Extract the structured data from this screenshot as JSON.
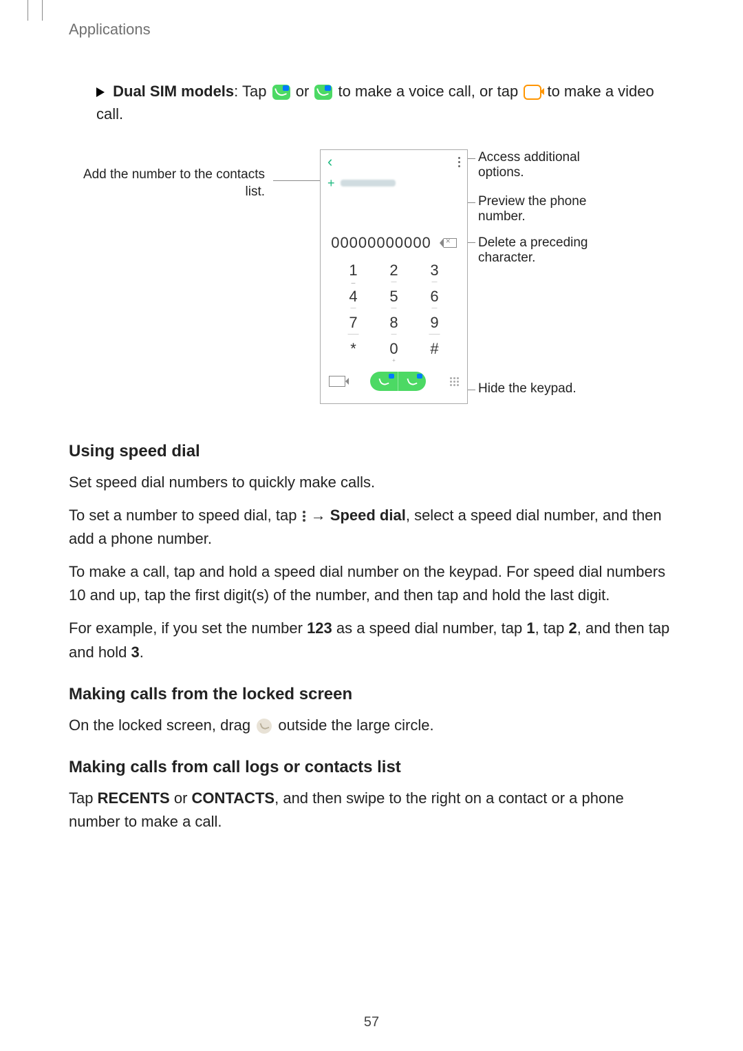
{
  "header": "Applications",
  "intro": {
    "lead": "Dual SIM models",
    "mid1": ": Tap ",
    "mid2": " or ",
    "mid3": " to make a voice call, or tap ",
    "tail": " to make a video call."
  },
  "annotations": {
    "add_contacts": "Add the number to the contacts list.",
    "access_options": "Access additional options.",
    "preview_number": "Preview the phone number.",
    "delete_char": "Delete a preceding character.",
    "hide_keypad": "Hide the keypad."
  },
  "phone": {
    "number_display": "00000000000",
    "keys": [
      "1",
      "2",
      "3",
      "4",
      "5",
      "6",
      "7",
      "8",
      "9",
      "*",
      "0",
      "#"
    ]
  },
  "sections": {
    "speed_dial": {
      "title": "Using speed dial",
      "p1": "Set speed dial numbers to quickly make calls.",
      "p2a": "To set a number to speed dial, tap ",
      "p2_arrow": " → ",
      "p2_bold": "Speed dial",
      "p2b": ", select a speed dial number, and then add a phone number.",
      "p3": "To make a call, tap and hold a speed dial number on the keypad. For speed dial numbers 10 and up, tap the first digit(s) of the number, and then tap and hold the last digit.",
      "p4a": "For example, if you set the number ",
      "p4_n1": "123",
      "p4b": " as a speed dial number, tap ",
      "p4_n2": "1",
      "p4c": ", tap ",
      "p4_n3": "2",
      "p4d": ", and then tap and hold ",
      "p4_n4": "3",
      "p4e": "."
    },
    "locked": {
      "title": "Making calls from the locked screen",
      "p1a": "On the locked screen, drag ",
      "p1b": " outside the large circle."
    },
    "logs": {
      "title": "Making calls from call logs or contacts list",
      "p1a": "Tap ",
      "p1_b1": "RECENTS",
      "p1b": " or ",
      "p1_b2": "CONTACTS",
      "p1c": ", and then swipe to the right on a contact or a phone number to make a call."
    }
  },
  "page_number": "57"
}
